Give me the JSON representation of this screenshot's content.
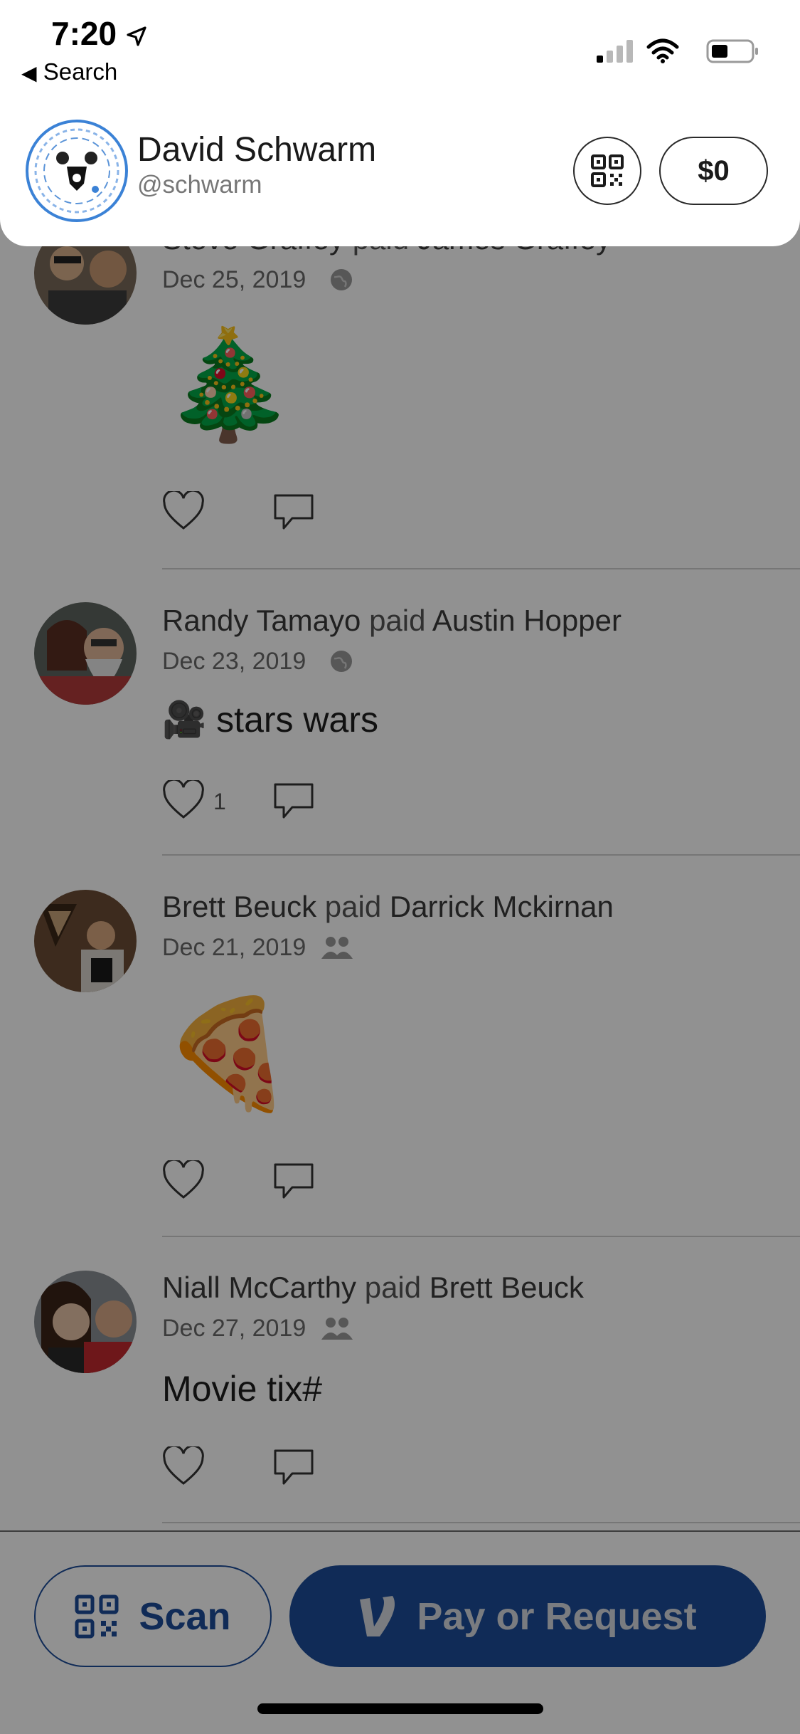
{
  "status_bar": {
    "time": "7:20",
    "back_label": "Search"
  },
  "profile": {
    "name": "David Schwarm",
    "handle": "@schwarm",
    "balance": "$0"
  },
  "feed": [
    {
      "payer": "Steve Graffey",
      "verb": "paid",
      "payee": "James Graffey",
      "date": "Dec 25, 2019",
      "privacy": "public",
      "note": "🎄",
      "likes": ""
    },
    {
      "payer": "Randy Tamayo",
      "verb": "paid",
      "payee": "Austin Hopper",
      "date": "Dec 23, 2019",
      "privacy": "public",
      "note_emoji": "🎥",
      "note": "stars wars",
      "likes": "1"
    },
    {
      "payer": "Brett Beuck",
      "verb": "paid",
      "payee": "Darrick Mckirnan",
      "date": "Dec 21, 2019",
      "privacy": "friends",
      "note": "🍕",
      "likes": ""
    },
    {
      "payer": "Niall McCarthy",
      "verb": "paid",
      "payee": "Brett Beuck",
      "date": "Dec 27, 2019",
      "privacy": "friends",
      "note": "Movie tix#",
      "likes": ""
    }
  ],
  "actions": {
    "scan_label": "Scan",
    "pay_label": "Pay or Request"
  },
  "colors": {
    "venmo_blue": "#1d4d99",
    "overlay": "rgba(0,0,0,0.43)",
    "code_ring": "#3b82d6"
  }
}
